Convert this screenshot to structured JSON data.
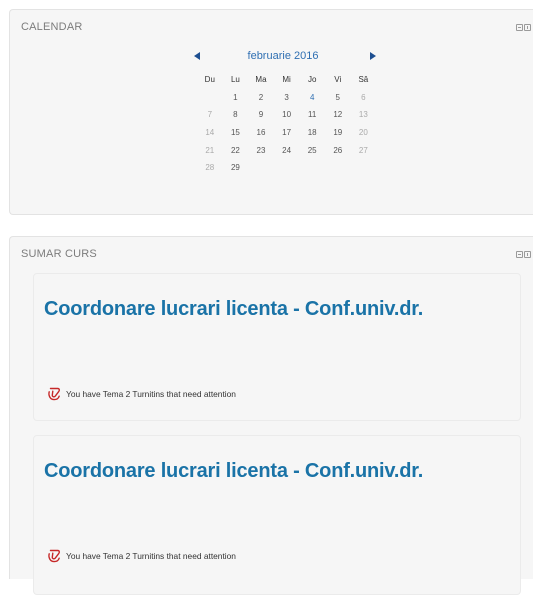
{
  "calendar": {
    "title": "CALENDAR",
    "month_label": "februarie 2016",
    "weekdays": [
      "Du",
      "Lu",
      "Ma",
      "Mi",
      "Jo",
      "Vi",
      "Sâ"
    ],
    "weeks": [
      [
        "",
        "1",
        "2",
        "3",
        "4",
        "5",
        "6"
      ],
      [
        "7",
        "8",
        "9",
        "10",
        "11",
        "12",
        "13"
      ],
      [
        "14",
        "15",
        "16",
        "17",
        "18",
        "19",
        "20"
      ],
      [
        "21",
        "22",
        "23",
        "24",
        "25",
        "26",
        "27"
      ],
      [
        "28",
        "29",
        "",
        "",
        "",
        "",
        ""
      ]
    ],
    "linked_days": [
      "4"
    ]
  },
  "summary": {
    "title": "SUMAR CURS",
    "courses": [
      {
        "title": "Coordonare lucrari licenta - Conf.univ.dr.",
        "notice_prefix": "You have ",
        "notice_link": "Tema 2 Turnitins",
        "notice_suffix": " that need attention"
      },
      {
        "title": "Coordonare lucrari licenta - Conf.univ.dr.",
        "notice_prefix": "You have ",
        "notice_link": "Tema 2 Turnitins",
        "notice_suffix": " that need attention"
      }
    ]
  },
  "colors": {
    "link_blue": "#1a73a7",
    "arrow_blue": "#1d4f91",
    "block_bg": "#f6f6f6"
  },
  "icons": [
    "hide-block-icon",
    "dock-block-icon",
    "prev-month-icon",
    "next-month-icon",
    "turnitin-icon"
  ]
}
